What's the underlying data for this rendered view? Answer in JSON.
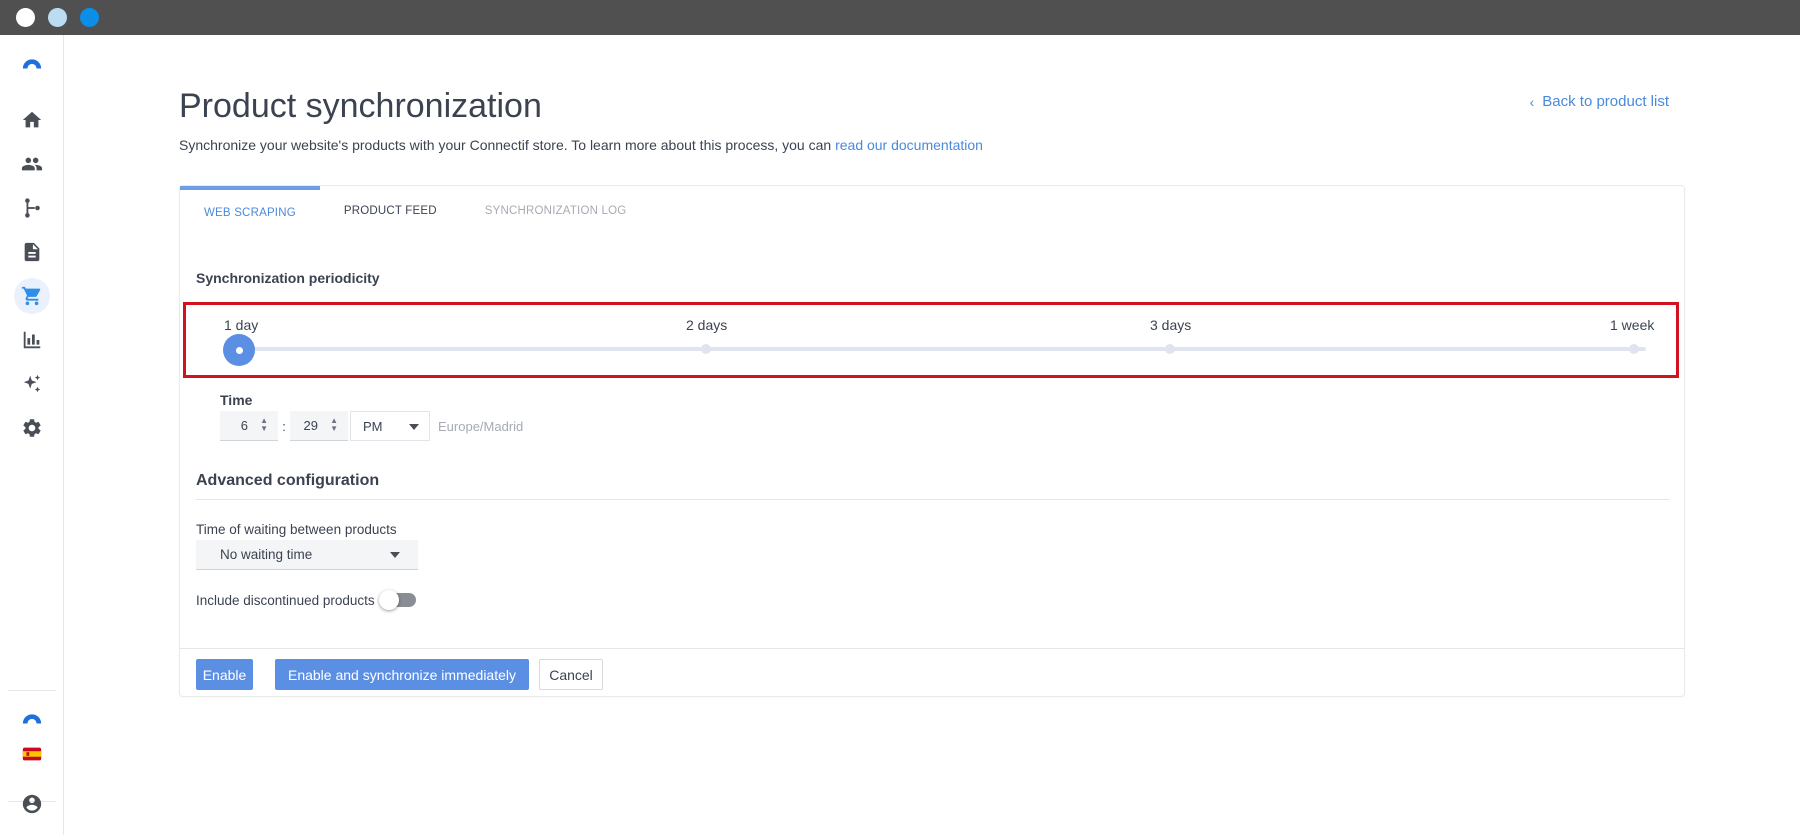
{
  "window": {
    "controls": [
      "close",
      "minimize",
      "maximize"
    ]
  },
  "sidebar": {
    "logo": "connectif-logo-icon",
    "items": [
      {
        "icon": "home-icon",
        "active": false
      },
      {
        "icon": "contacts-icon",
        "active": false
      },
      {
        "icon": "workflows-icon",
        "active": false
      },
      {
        "icon": "content-icon",
        "active": false
      },
      {
        "icon": "cart-icon",
        "active": true
      },
      {
        "icon": "reports-icon",
        "active": false
      },
      {
        "icon": "ai-sparkle-icon",
        "active": false
      },
      {
        "icon": "settings-icon",
        "active": false
      }
    ],
    "bottom": [
      "connectif-account-icon",
      "spain-flag-icon",
      "user-account-icon"
    ]
  },
  "header": {
    "title": "Product synchronization",
    "subtitle_text": "Synchronize your website's products with your Connectif store. To learn more about this process, you can ",
    "subtitle_link": "read our documentation",
    "back_link": "Back to product list"
  },
  "tabs": [
    {
      "label": "WEB SCRAPING",
      "state": "active"
    },
    {
      "label": "PRODUCT FEED",
      "state": "normal"
    },
    {
      "label": "SYNCHRONIZATION LOG",
      "state": "disabled"
    }
  ],
  "periodicity": {
    "label": "Synchronization periodicity",
    "options": [
      "1 day",
      "2 days",
      "3 days",
      "1 week"
    ],
    "selected_index": 0
  },
  "time": {
    "label": "Time",
    "hour": "6",
    "minute": "29",
    "ampm": "PM",
    "timezone": "Europe/Madrid"
  },
  "advanced": {
    "title": "Advanced configuration",
    "waiting_label": "Time of waiting between products",
    "waiting_value": "No waiting time",
    "discontinued_label": "Include discontinued products",
    "discontinued_enabled": false
  },
  "actions": {
    "enable": "Enable",
    "enable_sync": "Enable and synchronize immediately",
    "cancel": "Cancel"
  },
  "colors": {
    "accent": "#5b8fe4",
    "link": "#4a89dc",
    "highlight_border": "#d2131f",
    "titlebar": "#505050"
  }
}
